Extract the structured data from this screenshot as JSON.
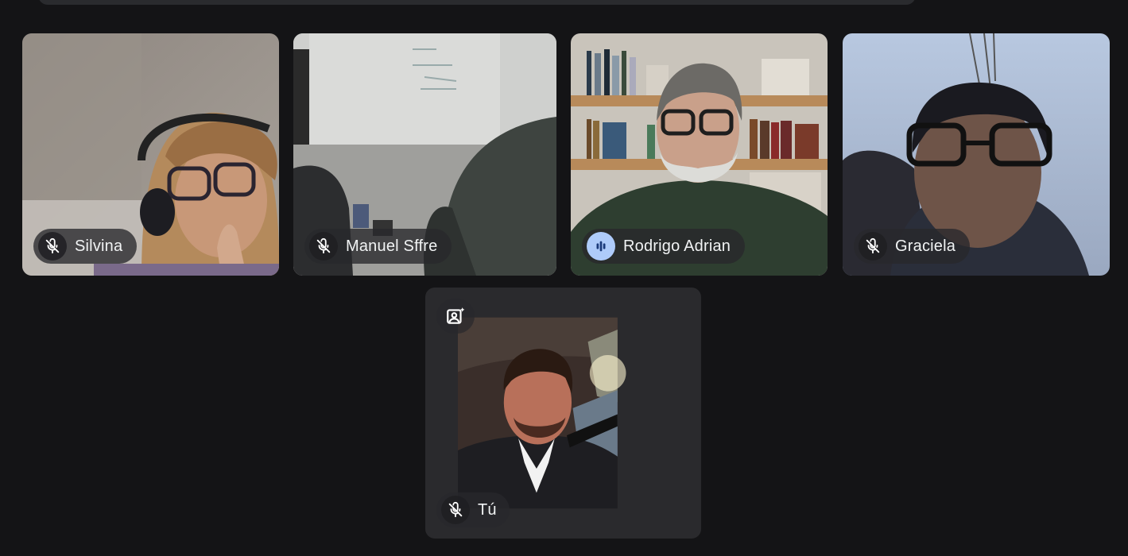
{
  "meeting": {
    "participants": [
      {
        "name": "Silvina",
        "mic": "muted",
        "mic_icon": "mic-off-icon"
      },
      {
        "name": "Manuel Sffre",
        "mic": "muted",
        "mic_icon": "mic-off-icon"
      },
      {
        "name": "Rodrigo Adrian",
        "mic": "speaking",
        "mic_icon": "audio-level-icon"
      },
      {
        "name": "Graciela",
        "mic": "muted",
        "mic_icon": "mic-off-icon"
      }
    ],
    "self": {
      "name": "Tú",
      "mic": "muted",
      "mic_icon": "mic-off-icon",
      "effects_icon": "background-effects-icon"
    }
  },
  "colors": {
    "background": "#141416",
    "pill": "#28282c",
    "speaking_indicator": "#aecbfa",
    "text": "#f1f3f4"
  }
}
